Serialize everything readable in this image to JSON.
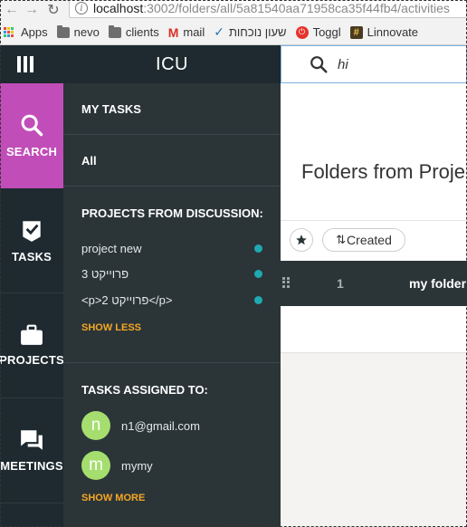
{
  "browser": {
    "url_host": "localhost",
    "url_path": ":3002/folders/all/5a81540aa71958ca35f44fb4/activities",
    "bookmarks": [
      {
        "label": "Apps",
        "icon": "apps-grid-icon"
      },
      {
        "label": "nevo",
        "icon": "folder-icon"
      },
      {
        "label": "clients",
        "icon": "folder-icon"
      },
      {
        "label": "mail",
        "icon": "gmail-icon"
      },
      {
        "label": "שעון נוכחות",
        "icon": "checkmark-icon"
      },
      {
        "label": "Toggl",
        "icon": "toggl-power-icon"
      },
      {
        "label": "Linnovate",
        "icon": "slack-hash-icon"
      }
    ]
  },
  "rail": {
    "items": [
      {
        "label": "SEARCH",
        "icon": "search-icon",
        "active": true
      },
      {
        "label": "TASKS",
        "icon": "tasks-check-icon",
        "active": false
      },
      {
        "label": "PROJECTS",
        "icon": "briefcase-icon",
        "active": false
      },
      {
        "label": "MEETINGS",
        "icon": "chat-bubbles-icon",
        "active": false
      }
    ]
  },
  "panel": {
    "app_title": "ICU",
    "my_tasks": "MY TASKS",
    "all": "All",
    "projects_title": "PROJECTS FROM DISCUSSION:",
    "projects": [
      {
        "name": "project new"
      },
      {
        "name": "3 פרוייקט"
      },
      {
        "name": "<p>2 פרוייקט</p>"
      }
    ],
    "show_less": "SHOW LESS",
    "assigned_title": "TASKS ASSIGNED TO:",
    "users": [
      {
        "initial": "n",
        "name": "n1@gmail.com"
      },
      {
        "initial": "m",
        "name": "mymy"
      }
    ],
    "show_more": "SHOW MORE"
  },
  "main": {
    "search_value": "hi",
    "title": "Folders from Proje",
    "sort_label": "Created",
    "table_header": {
      "num": "1",
      "name": "my folder"
    }
  },
  "colors": {
    "active_rail": "#c14db8",
    "rail_bg": "#1e2a2f",
    "panel_bg": "#2b3538",
    "dot": "#1fa9b3",
    "link": "#f6a623",
    "avatar": "#a5de6e"
  }
}
